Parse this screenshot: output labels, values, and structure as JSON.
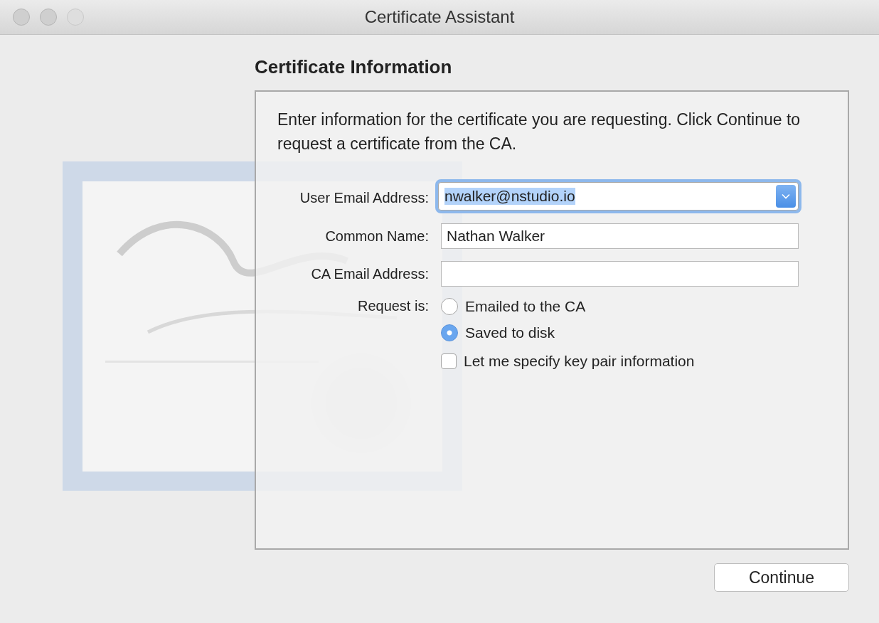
{
  "window": {
    "title": "Certificate Assistant"
  },
  "heading": "Certificate Information",
  "intro": "Enter information for the certificate you are requesting. Click Continue to request a certificate from the CA.",
  "fields": [
    {
      "kind": "combo",
      "label": "User Email Address:",
      "value": "nwalker@nstudio.io",
      "focused": true
    },
    {
      "kind": "text",
      "label": "Common Name:",
      "value": "Nathan Walker",
      "focused": false
    },
    {
      "kind": "text",
      "label": "CA Email Address:",
      "focused": false
    }
  ],
  "request": {
    "label": "Request is:",
    "options": [
      {
        "label": "Emailed to the CA",
        "selected": false
      },
      {
        "label": "Saved to disk",
        "selected": true
      }
    ]
  },
  "key_pair": {
    "label": "Let me specify key pair information",
    "checked": false
  },
  "buttons": [
    {
      "label": "Continue"
    }
  ]
}
